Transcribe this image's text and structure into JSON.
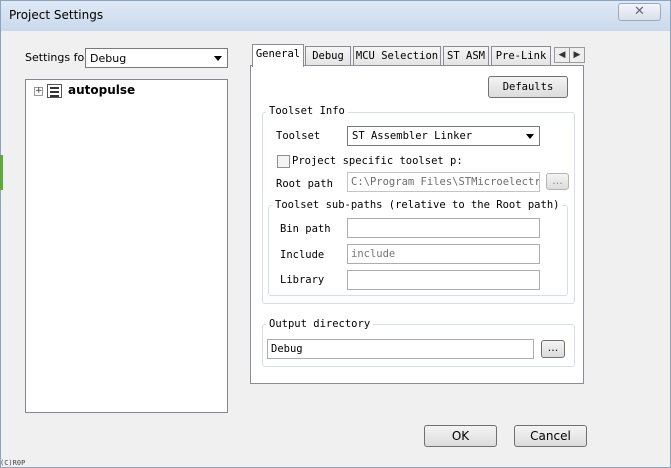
{
  "window": {
    "title": "Project Settings",
    "close_glyph": "✕"
  },
  "sidebar": {
    "settings_for_label": "Settings for:",
    "settings_for_value": "Debug",
    "tree": [
      {
        "label": "autopulse",
        "expander": "+"
      }
    ]
  },
  "tabs": [
    "General",
    "Debug",
    "MCU Selection",
    "ST ASM",
    "Pre-Link"
  ],
  "tab_scroll": {
    "left": "◀",
    "right": "▶"
  },
  "general": {
    "defaults_label": "Defaults",
    "toolset_info_title": "Toolset Info",
    "toolset_label": "Toolset",
    "toolset_value": "ST Assembler Linker",
    "project_specific_label": "Project specific toolset p:",
    "root_path_label": "Root path",
    "root_path_value": "C:\\Program Files\\STMicroelectro",
    "browse_label": "...",
    "subpaths_title": "Toolset sub-paths (relative to the Root path)",
    "bin_path_label": "Bin path",
    "bin_path_value": "",
    "include_label": "Include",
    "include_placeholder": "include",
    "library_label": "Library",
    "library_value": "",
    "output_title": "Output directory",
    "output_value": "Debug",
    "output_browse_label": "..."
  },
  "footer": {
    "ok_label": "OK",
    "cancel_label": "Cancel"
  },
  "background_fragment": "(C)R0P"
}
